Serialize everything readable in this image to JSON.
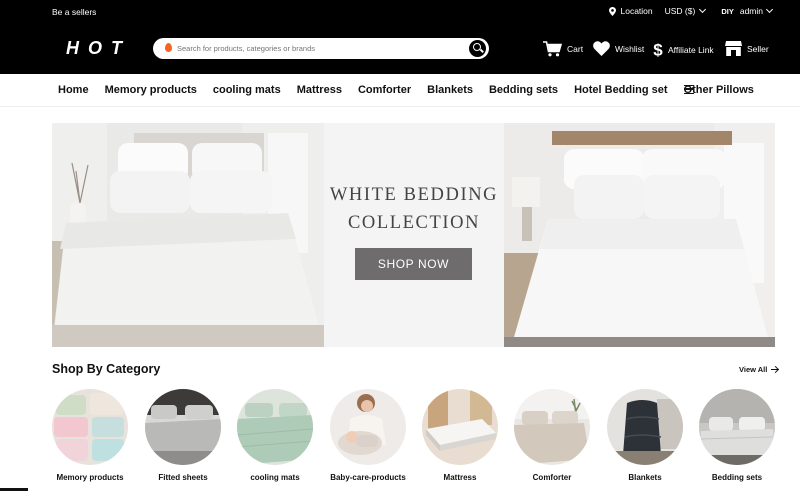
{
  "topbar": {
    "seller_link": "Be a sellers",
    "location": "Location",
    "currency": "USD ($)",
    "user_badge": "DIY",
    "user_name": "admin"
  },
  "header": {
    "logo": "HOT",
    "search_placeholder": "Search for products, categories or brands",
    "cart": "Cart",
    "wishlist": "Wishlist",
    "affiliate": "Affiliate Link",
    "seller": "Seller"
  },
  "nav": {
    "items": [
      "Home",
      "Memory products",
      "cooling mats",
      "Mattress",
      "Comforter",
      "Blankets",
      "Bedding sets",
      "Hotel Bedding set",
      "Other Pillows"
    ]
  },
  "banner": {
    "title_line1": "WHITE BEDDING",
    "title_line2": "COLLECTION",
    "cta": "SHOP NOW"
  },
  "categories": {
    "title": "Shop By Category",
    "view_all": "View All",
    "items": [
      {
        "label": "Memory products"
      },
      {
        "label": "Fitted sheets"
      },
      {
        "label": "cooling mats"
      },
      {
        "label": "Baby-care-products"
      },
      {
        "label": "Mattress"
      },
      {
        "label": "Comforter"
      },
      {
        "label": "Blankets"
      },
      {
        "label": "Bedding sets"
      }
    ]
  },
  "colors": {
    "header_bg": "#000000",
    "accent": "#f26522",
    "cta_bg": "#6e6c6c"
  }
}
